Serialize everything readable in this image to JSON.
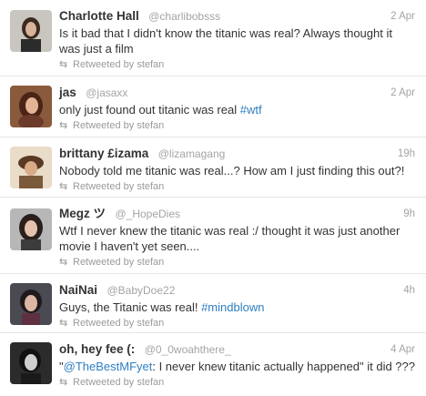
{
  "tweets": [
    {
      "name": "Charlotte Hall",
      "handle": "@charlibobsss",
      "time": "2 Apr",
      "text": "Is it bad that I didn't know the titanic was real? Always thought it was just a film",
      "retweeted": "Retweeted by stefan"
    },
    {
      "name": "jas",
      "handle": "@jasaxx",
      "time": "2 Apr",
      "text": "only just found out titanic was real ",
      "hashtag": "#wtf",
      "retweeted": "Retweeted by stefan"
    },
    {
      "name": "brittany £izama",
      "handle": "@lizamagang",
      "time": "19h",
      "text": "Nobody told me titanic was real...? How am I just finding this out?!",
      "retweeted": "Retweeted by stefan"
    },
    {
      "name": "Megz ツ",
      "handle": "@_HopeDies",
      "time": "9h",
      "text": "Wtf I never knew the titanic was real :/ thought it was just another movie I haven't yet seen....",
      "retweeted": "Retweeted by stefan"
    },
    {
      "name": "NaiNai",
      "handle": "@BabyDoe22",
      "time": "4h",
      "text": "Guys, the Titanic was real! ",
      "hashtag": "#mindblown",
      "retweeted": "Retweeted by stefan"
    },
    {
      "name": "oh, hey fee (:",
      "handle": "@0_0woahthere_",
      "time": "4 Apr",
      "text_prefix": "\"",
      "mention": "@TheBestMFyet",
      "text": ": I never knew titanic actually happened\" it did ???",
      "retweeted": "Retweeted by stefan"
    }
  ],
  "icons": {
    "retweet": "retweet-icon"
  },
  "colors": {
    "link": "#2f7fc2",
    "name": "#333333",
    "meta": "#a4a4a4"
  }
}
